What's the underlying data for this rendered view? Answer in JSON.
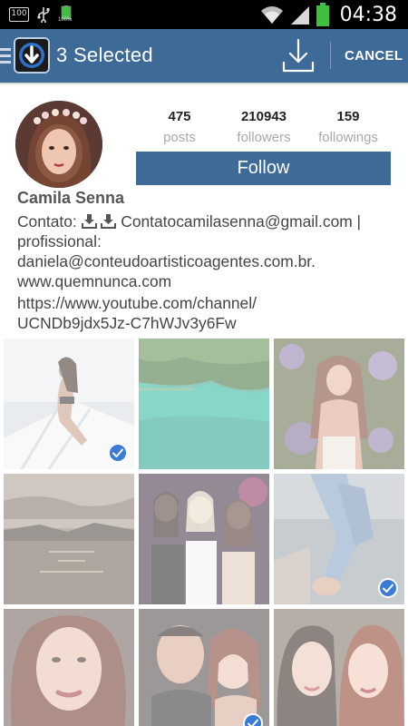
{
  "status_bar": {
    "notification_badge": "100",
    "battery_small_label": "100%",
    "time": "04:38",
    "icons": [
      "notification-100-icon",
      "usb-icon",
      "battery-full-small-icon",
      "wifi-icon",
      "signal-icon",
      "battery-icon"
    ]
  },
  "action_bar": {
    "title": "3 Selected",
    "cancel_label": "CANCEL",
    "icons": [
      "menu-icon",
      "app-logo-icon",
      "download-icon"
    ],
    "color": "#3d6a96"
  },
  "profile": {
    "name": "Camila Senna",
    "stats": [
      {
        "value": "475",
        "label": "posts"
      },
      {
        "value": "210943",
        "label": "followers"
      },
      {
        "value": "159",
        "label": "followings"
      }
    ],
    "follow_label": "Follow",
    "bio": {
      "contact_prefix": "Contato:",
      "contact_email": "Contatocamilasenna@gmail.com |",
      "line2": "profissional:",
      "line3": "daniela@conteudoartisticoagentes.com.br.",
      "line4": "www.quemnunca.com"
    },
    "link_line1": "https://www.youtube.com/channel/",
    "link_line2": "UCNDb9jdx5Jz-C7hWJv3y6Fw"
  },
  "grid": {
    "selected_count": 3,
    "items": [
      {
        "name": "photo-boat-pose",
        "selected": true
      },
      {
        "name": "photo-green-lagoon",
        "selected": false
      },
      {
        "name": "photo-garden-portrait",
        "selected": false
      },
      {
        "name": "photo-sunset-bay",
        "selected": false
      },
      {
        "name": "photo-party-friends",
        "selected": false
      },
      {
        "name": "photo-denim-legs",
        "selected": true
      },
      {
        "name": "photo-closeup-portrait",
        "selected": false
      },
      {
        "name": "photo-selfie-man",
        "selected": true
      },
      {
        "name": "photo-two-women",
        "selected": false
      }
    ]
  }
}
